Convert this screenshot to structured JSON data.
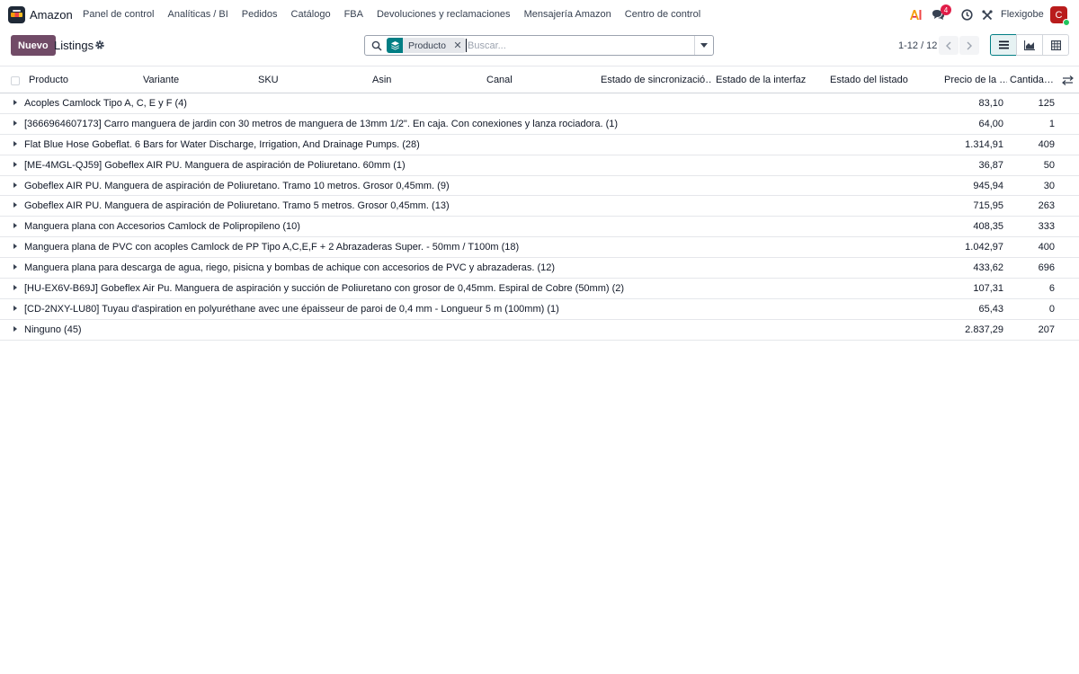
{
  "navbar": {
    "brand": "Amazon",
    "menu": [
      "Panel de control",
      "Analíticas / BI",
      "Pedidos",
      "Catálogo",
      "FBA",
      "Devoluciones y reclamaciones",
      "Mensajería Amazon",
      "Centro de control"
    ],
    "messages_count": "4",
    "company": "Flexigobe",
    "avatar_letter": "C",
    "icons": [
      "ai-icon",
      "chat-icon",
      "clock-icon",
      "tools-icon"
    ]
  },
  "control": {
    "new_label": "Nuevo",
    "title": "Listings",
    "facet_label": "Producto",
    "search_placeholder": "Buscar...",
    "pager": "1-12 / 12"
  },
  "table": {
    "columns": [
      "Producto",
      "Variante",
      "SKU",
      "Asin",
      "Canal",
      "Estado de sincronizació…",
      "Estado de la interfaz",
      "Estado del listado",
      "Precio de la …",
      "Cantida…"
    ],
    "groups": [
      {
        "label": "Acoples Camlock Tipo A, C, E y F (4)",
        "price": "83,10",
        "qty": "125"
      },
      {
        "label": "[3666964607173] Carro manguera de jardin con 30 metros de manguera de 13mm 1/2\". En caja. Con conexiones y lanza rociadora. (1)",
        "price": "64,00",
        "qty": "1"
      },
      {
        "label": "Flat Blue Hose Gobeflat. 6 Bars for Water Discharge, Irrigation, And Drainage Pumps. (28)",
        "price": "1.314,91",
        "qty": "409"
      },
      {
        "label": "[ME-4MGL-QJ59] Gobeflex AIR PU. Manguera de aspiración de Poliuretano. 60mm (1)",
        "price": "36,87",
        "qty": "50"
      },
      {
        "label": "Gobeflex AIR PU. Manguera de aspiración de Poliuretano. Tramo 10 metros. Grosor 0,45mm. (9)",
        "price": "945,94",
        "qty": "30"
      },
      {
        "label": "Gobeflex AIR PU. Manguera de aspiración de Poliuretano. Tramo 5 metros. Grosor 0,45mm. (13)",
        "price": "715,95",
        "qty": "263"
      },
      {
        "label": "Manguera plana con Accesorios Camlock de Polipropileno (10)",
        "price": "408,35",
        "qty": "333"
      },
      {
        "label": "Manguera plana de PVC con acoples Camlock de PP Tipo A,C,E,F + 2 Abrazaderas Super. - 50mm / T100m (18)",
        "price": "1.042,97",
        "qty": "400"
      },
      {
        "label": "Manguera plana para descarga de agua, riego, pisicna y bombas de achique con accesorios de PVC y abrazaderas. (12)",
        "price": "433,62",
        "qty": "696"
      },
      {
        "label": "[HU-EX6V-B69J] Gobeflex Air Pu. Manguera de aspiración y succión de Poliuretano con grosor de 0,45mm. Espiral de Cobre (50mm) (2)",
        "price": "107,31",
        "qty": "6"
      },
      {
        "label": "[CD-2NXY-LU80] Tuyau d'aspiration en polyuréthane avec une épaisseur de paroi de 0,4 mm - Longueur 5 m (100mm) (1)",
        "price": "65,43",
        "qty": "0"
      },
      {
        "label": "Ninguno (45)",
        "price": "2.837,29",
        "qty": "207"
      }
    ]
  },
  "colors": {
    "primary": "#714b67",
    "accent": "#017e84",
    "badge": "#e11d48",
    "avatar": "#b91c1c"
  }
}
